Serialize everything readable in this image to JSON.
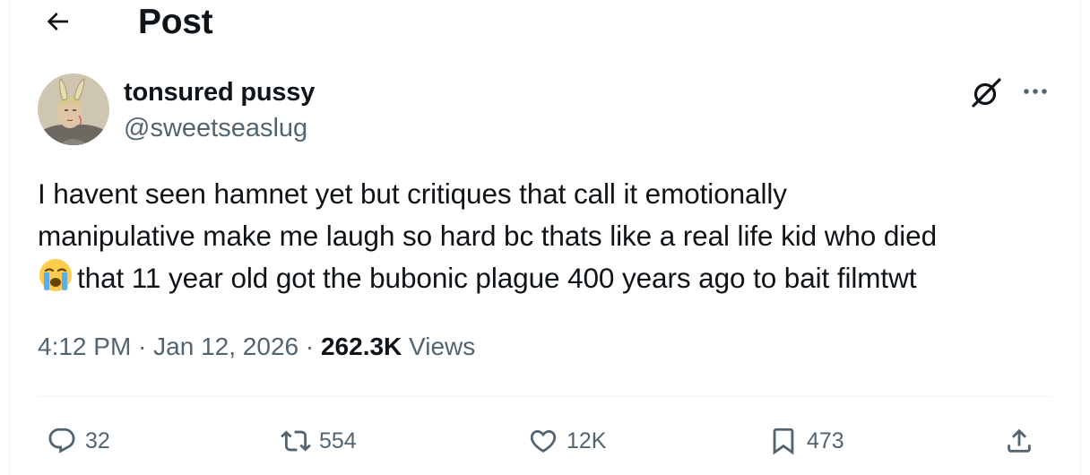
{
  "header": {
    "title": "Post",
    "back_icon": "arrow-left-icon"
  },
  "author": {
    "display_name": "tonsured pussy",
    "handle": "@sweetseaslug",
    "avatar_icon": "avatar-monk-with-bunny-ears"
  },
  "top_actions": {
    "grok_icon": "grok-icon",
    "more_icon": "more-horizontal-icon"
  },
  "tweet": {
    "line1": "I havent seen hamnet yet but critiques that call it emotionally",
    "line2": "manipulative make me laugh so hard bc thats like a real life kid who died",
    "emoji": "loudly-crying-face-emoji",
    "line3": "that 11 year old got the bubonic plague 400 years ago to bait filmtwt"
  },
  "meta": {
    "time": "4:12 PM",
    "sep1": " · ",
    "date": "Jan 12, 2026",
    "sep2": " · ",
    "views_count": "262.3K",
    "views_label": " Views"
  },
  "actions": {
    "reply_count": "32",
    "retweet_count": "554",
    "like_count": "12K",
    "bookmark_count": "473",
    "icons": [
      "reply-icon",
      "retweet-icon",
      "like-icon",
      "bookmark-icon",
      "share-icon"
    ]
  },
  "colors": {
    "text": "#0f1419",
    "secondary": "#536471",
    "divider": "#eff3f4",
    "background": "#ffffff"
  }
}
